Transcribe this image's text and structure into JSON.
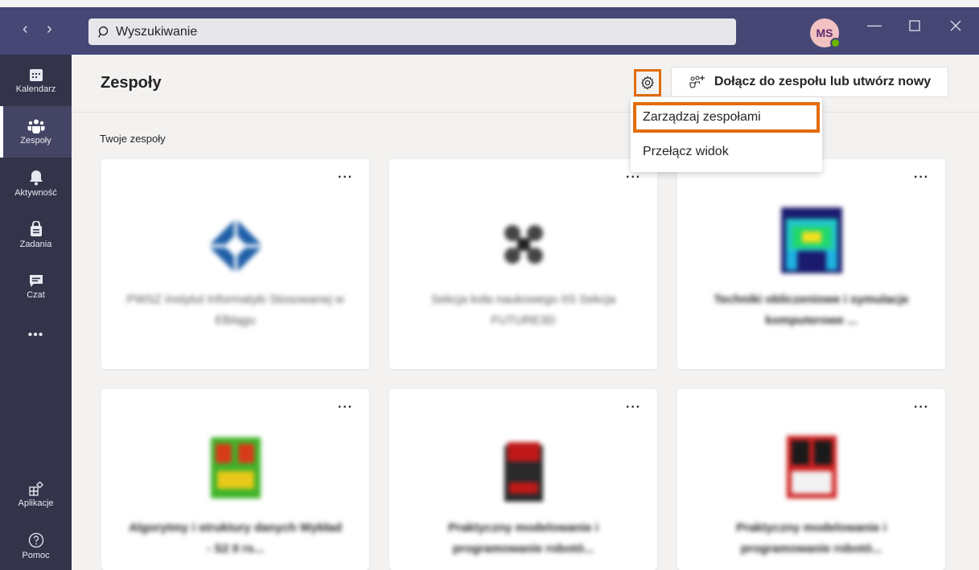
{
  "search": {
    "placeholder": "Wyszukiwanie"
  },
  "user": {
    "initials": "MS",
    "presence_color": "#6bb700"
  },
  "rail": {
    "items": [
      {
        "label": "Kalendarz",
        "icon": "calendar-icon"
      },
      {
        "label": "Zespoły",
        "icon": "teams-icon",
        "active": true
      },
      {
        "label": "Aktywność",
        "icon": "bell-icon"
      },
      {
        "label": "Zadania",
        "icon": "assignments-icon"
      },
      {
        "label": "Czat",
        "icon": "chat-icon"
      }
    ],
    "more": "•••",
    "apps_label": "Aplikacje",
    "help_label": "Pomoc"
  },
  "header": {
    "title": "Zespoły",
    "join_label": "Dołącz do zespołu lub utwórz nowy"
  },
  "menu": {
    "items": [
      "Zarządzaj zespołami",
      "Przełącz widok"
    ]
  },
  "section": {
    "title": "Twoje zespoły"
  },
  "cards": [
    {
      "name": "PWSZ Instytut Informatyki Stosowanej w Elblągu",
      "more": "···"
    },
    {
      "name": "Sekcja koła naukowego IIS Sekcja FUTURE3D",
      "more": "···"
    },
    {
      "name": "Techniki obliczeniowe i symulacje komputerowe ...",
      "more": "···"
    },
    {
      "name": "Algorytmy i struktury danych Wykład - S2 II rs...",
      "more": "···"
    },
    {
      "name": "Praktyczny modelowanie i programowanie robotó...",
      "more": "···"
    },
    {
      "name": "Praktyczny modelowanie i programowanie robotó...",
      "more": "···"
    }
  ],
  "colors": {
    "topbar": "#464775",
    "rail": "#33344a",
    "accent_highlight": "#e26c0a"
  }
}
